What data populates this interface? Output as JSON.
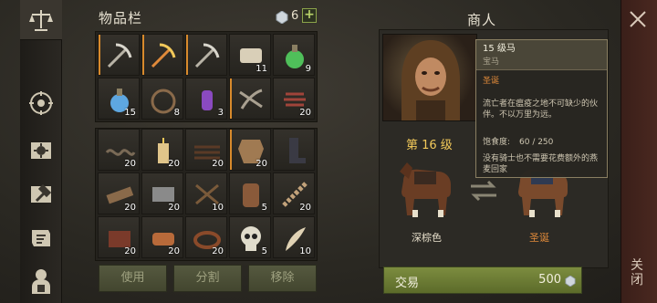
{
  "sidebar": {
    "items": [
      {
        "icon": "scales-icon",
        "active": true
      },
      {
        "icon": "compass-icon",
        "active": false
      },
      {
        "icon": "sun-book-icon",
        "active": false
      },
      {
        "icon": "hammer-icon",
        "active": false
      },
      {
        "icon": "scroll-map-icon",
        "active": false
      },
      {
        "icon": "knight-icon",
        "active": false
      }
    ]
  },
  "inventory": {
    "title": "物品栏",
    "gem_count": "6",
    "add_label": "+",
    "equipped": [
      {
        "icon": "pickaxe-icon",
        "qty": "",
        "selected": true
      },
      {
        "icon": "fire-pickaxe-icon",
        "qty": "",
        "selected": true
      },
      {
        "icon": "pickaxe-icon",
        "qty": "",
        "selected": true
      },
      {
        "icon": "scroll-icon",
        "qty": "11",
        "selected": false
      },
      {
        "icon": "green-potion-icon",
        "qty": "9",
        "selected": false
      },
      {
        "icon": "blue-potion-icon",
        "qty": "15",
        "selected": false
      },
      {
        "icon": "bear-trap-icon",
        "qty": "8",
        "selected": false
      },
      {
        "icon": "purple-potion-icon",
        "qty": "3",
        "selected": false
      },
      {
        "icon": "crossbow-icon",
        "qty": "",
        "selected": true
      },
      {
        "icon": "red-fiber-icon",
        "qty": "20",
        "selected": false
      }
    ],
    "items": [
      {
        "icon": "rope-icon",
        "qty": "20",
        "selected": false
      },
      {
        "icon": "candle-icon",
        "qty": "20",
        "selected": false
      },
      {
        "icon": "leather-strips-icon",
        "qty": "20",
        "selected": false
      },
      {
        "icon": "hide-icon",
        "qty": "20",
        "selected": true
      },
      {
        "icon": "boots-icon",
        "qty": "",
        "selected": false
      },
      {
        "icon": "wood-plank-icon",
        "qty": "20",
        "selected": false
      },
      {
        "icon": "stone-block-icon",
        "qty": "20",
        "selected": false
      },
      {
        "icon": "sticks-icon",
        "qty": "10",
        "selected": false
      },
      {
        "icon": "barrel-icon",
        "qty": "5",
        "selected": false
      },
      {
        "icon": "rope-coil-icon",
        "qty": "20",
        "selected": false
      },
      {
        "icon": "leather-roll-icon",
        "qty": "20",
        "selected": false
      },
      {
        "icon": "copper-ingot-icon",
        "qty": "20",
        "selected": false
      },
      {
        "icon": "leather-strap-icon",
        "qty": "20",
        "selected": false
      },
      {
        "icon": "skull-icon",
        "qty": "5",
        "selected": false
      },
      {
        "icon": "horn-icon",
        "qty": "10",
        "selected": false
      }
    ],
    "buttons": {
      "use": "使用",
      "split": "分割",
      "remove": "移除"
    }
  },
  "merchant": {
    "title": "商人",
    "level": "第 16 级",
    "horse_left_label": "深棕色",
    "horse_right_label": "圣诞",
    "trade_label": "交易",
    "trade_price": "500"
  },
  "tooltip": {
    "name": "15 级马",
    "category": "宝马",
    "tag": "圣诞",
    "description": "流亡者在瘟疫之地不可缺少的伙伴。不以万里为远。",
    "satiety_label": "饱食度:",
    "satiety_value": "60 / 250",
    "footer": "没有骑士也不需要花费额外的燕麦回家"
  },
  "close_panel": {
    "label": "关闭"
  },
  "colors": {
    "accent": "#d88a2c",
    "gold": "#f2c95a",
    "trade_green": "#6f7f36",
    "tag_orange": "#e08a3a"
  }
}
